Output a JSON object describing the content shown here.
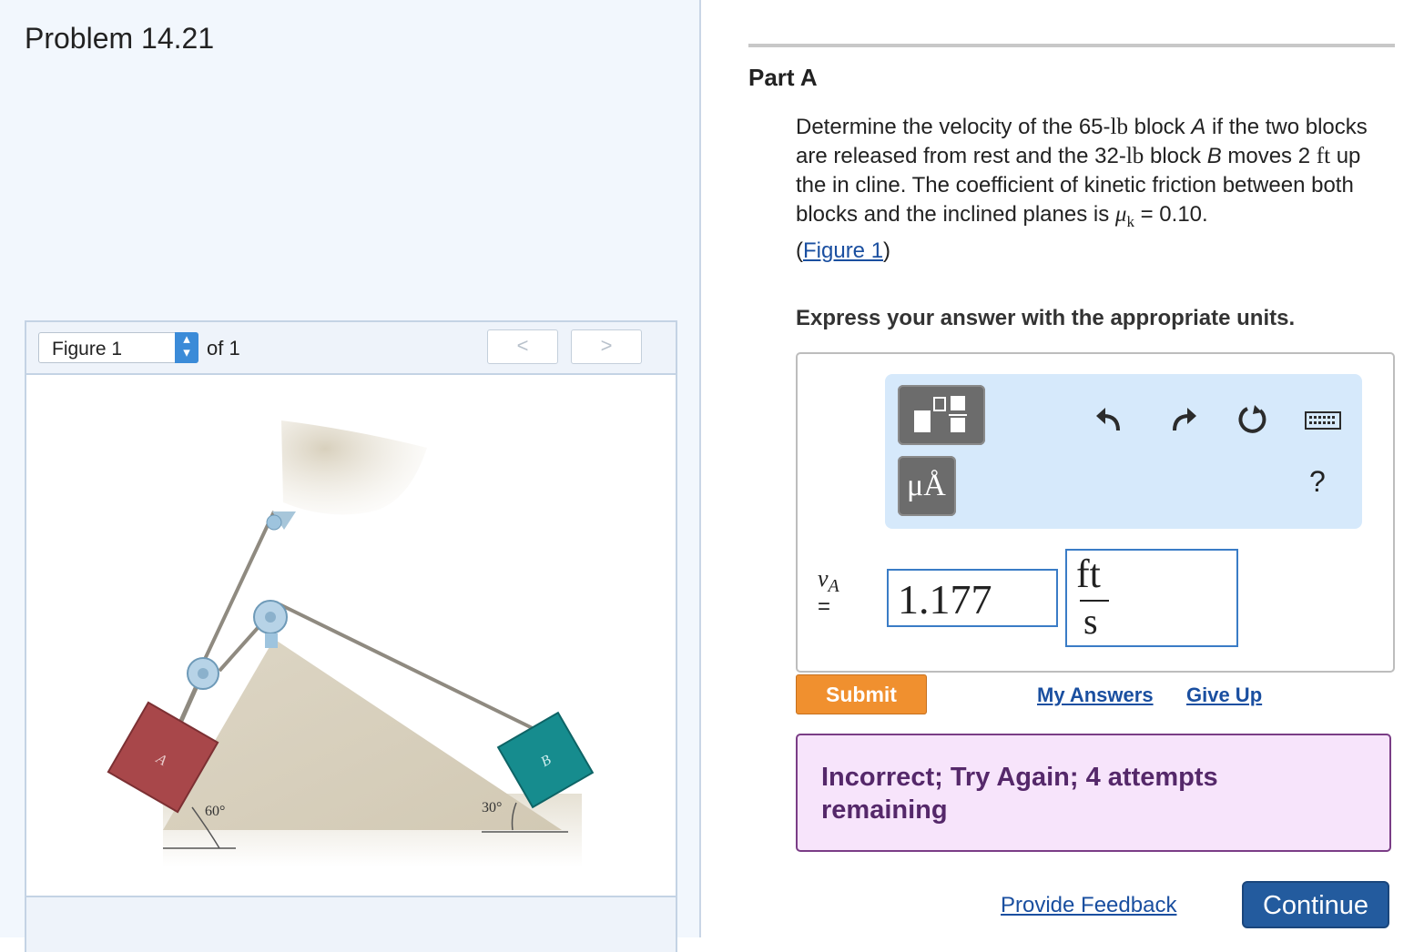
{
  "problem": {
    "title": "Problem 14.21"
  },
  "figure_panel": {
    "select_value": "Figure 1",
    "of_label": "of 1",
    "prev_glyph": "<",
    "next_glyph": ">",
    "figure": {
      "block_a_label": "A",
      "block_b_label": "B",
      "angle_left": "60°",
      "angle_right": "30°"
    }
  },
  "part": {
    "title": "Part A",
    "question": {
      "t1": "Determine the velocity of the 65-",
      "u1": "lb",
      "t2": " block ",
      "var_a": "A",
      "t3": " if the two blocks are released from rest and the 32-",
      "u2": "lb",
      "t4": " block ",
      "var_b": "B",
      "t5": " moves 2 ",
      "u3": "ft",
      "t6": " up the in cline. The coefficient of kinetic friction between both blocks and the inclined planes is ",
      "mu": "μ",
      "mu_sub": "k",
      "t7": " = 0.10.",
      "fig_open": "(",
      "fig_link": "Figure 1",
      "fig_close": ")"
    },
    "instruction": "Express your answer with the appropriate units."
  },
  "answer": {
    "toolbar": {
      "units_button_label": "μÅ",
      "help_label": "?"
    },
    "variable": "v",
    "variable_sub": "A",
    "equals": "=",
    "value": "1.177",
    "unit_numerator": "ft",
    "unit_denominator": "s"
  },
  "actions": {
    "submit": "Submit",
    "my_answers": "My Answers",
    "give_up": "Give Up"
  },
  "feedback": {
    "message": "Incorrect; Try Again; 4 attempts remaining"
  },
  "footer": {
    "provide_feedback": "Provide Feedback",
    "continue": "Continue"
  },
  "colors": {
    "block_a": "#a8474a",
    "block_b": "#168c8e",
    "submit": "#f0902f",
    "continue": "#235b9e",
    "feedback_bg": "#f7e4fb",
    "feedback_text": "#55286a"
  }
}
